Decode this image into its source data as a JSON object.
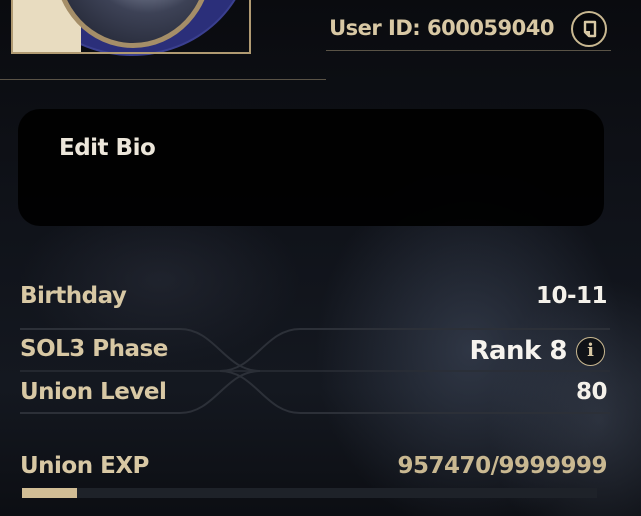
{
  "profile": {
    "user_id_label": "User ID: 600059040",
    "copy_icon": "copy-icon",
    "bio_label": "Edit Bio"
  },
  "stats": {
    "birthday_label": "Birthday",
    "birthday_value": "10-11",
    "sol3_label": "SOL3 Phase",
    "sol3_value": "Rank 8",
    "info_icon": "info-icon",
    "info_glyph": "i",
    "union_level_label": "Union Level",
    "union_level_value": "80",
    "union_exp_label": "Union EXP",
    "union_exp_value": "957470/9999999",
    "union_exp_progress": 0.0957
  },
  "colors": {
    "label_gold": "#d8c8a4",
    "value_white": "#f4f1ea",
    "exp_fill": "#d1bd95"
  }
}
